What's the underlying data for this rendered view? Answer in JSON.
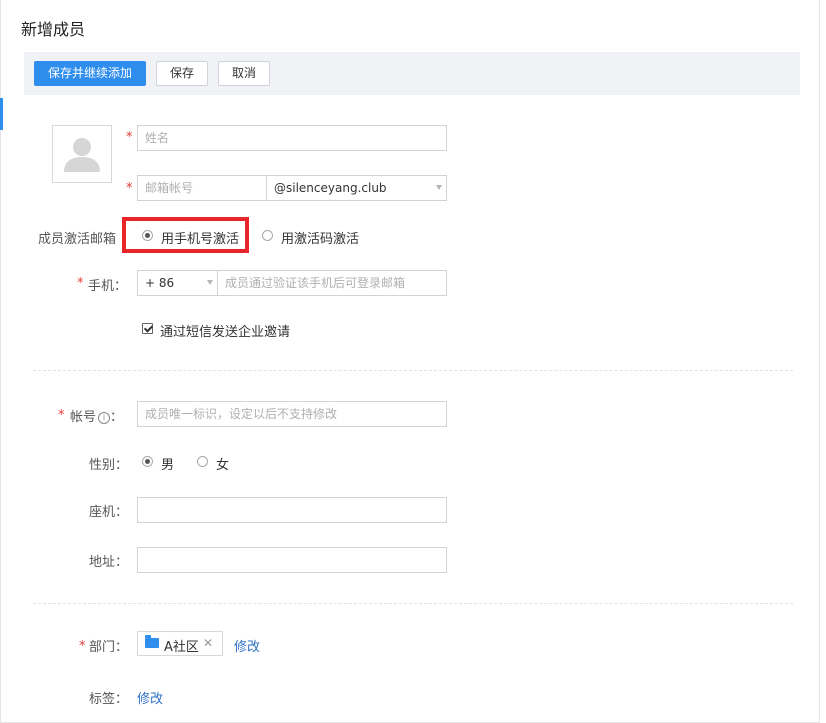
{
  "page": {
    "title": "新增成员"
  },
  "toolbar": {
    "save_continue": "保存并继续添加",
    "save": "保存",
    "cancel": "取消"
  },
  "form": {
    "required_mark": "*",
    "name": {
      "placeholder": "姓名"
    },
    "email": {
      "placeholder": "邮箱帐号",
      "domain": "@silenceyang.club"
    },
    "activation": {
      "label": "成员激活邮箱",
      "options": [
        {
          "label": "用手机号激活",
          "selected": true
        },
        {
          "label": "用激活码激活",
          "selected": false
        }
      ]
    },
    "phone": {
      "label": "手机：",
      "country_code": "+ 86",
      "placeholder": "成员通过验证该手机后可登录邮箱"
    },
    "sms_invite": {
      "label": "通过短信发送企业邀请",
      "checked": true
    },
    "account": {
      "label": "帐号",
      "colon": "：",
      "info_icon": "i",
      "placeholder": "成员唯一标识，设定以后不支持修改"
    },
    "gender": {
      "label": "性别：",
      "options": [
        {
          "label": "男",
          "selected": true
        },
        {
          "label": "女",
          "selected": false
        }
      ]
    },
    "landline": {
      "label": "座机：",
      "value": ""
    },
    "address": {
      "label": "地址：",
      "value": ""
    },
    "department": {
      "label": "部门：",
      "tag": "A社区",
      "remove": "✕",
      "edit": "修改"
    },
    "tags": {
      "label": "标签：",
      "edit": "修改"
    }
  },
  "colors": {
    "accent": "#2e8ded",
    "link": "#2e72c6",
    "required": "#e53935",
    "highlight": "#e8262a"
  }
}
